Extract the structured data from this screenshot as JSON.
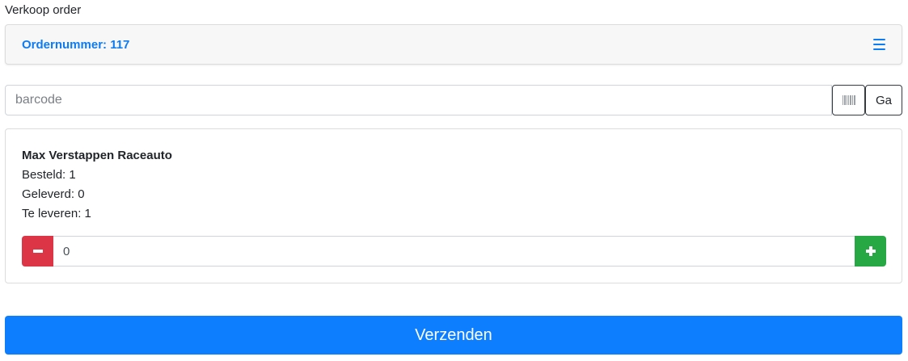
{
  "page": {
    "title": "Verkoop order"
  },
  "order": {
    "title": "Ordernummer: 117",
    "menu_icon": "hamburger-menu-icon"
  },
  "barcode": {
    "placeholder": "barcode",
    "value": "",
    "scan_icon": "barcode-icon",
    "go_label": "Ga"
  },
  "item": {
    "name": "Max Verstappen Raceauto",
    "ordered": "Besteld: 1",
    "delivered": "Geleverd: 0",
    "to_deliver": "Te leveren: 1",
    "quantity": "0",
    "minus_icon": "minus-icon",
    "plus_icon": "plus-icon"
  },
  "submit": {
    "label": "Verzenden"
  },
  "colors": {
    "primary": "#0d7efe",
    "danger": "#dc3545",
    "success": "#28a745",
    "link": "#0d7bf2"
  }
}
